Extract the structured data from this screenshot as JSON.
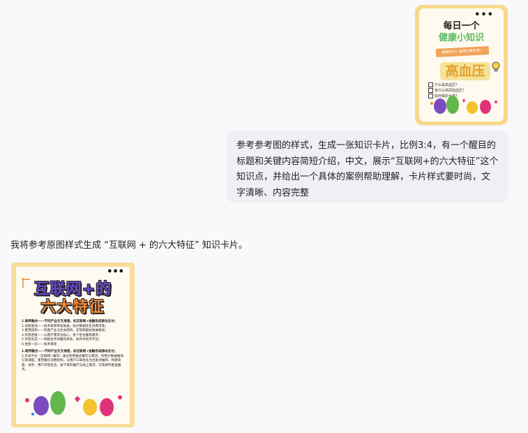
{
  "reference_card": {
    "title_line1": "每日一个",
    "title_line2": "健康小知识",
    "tag": "健康知识！每周分享好看！",
    "big_word": "高血压",
    "questions": [
      "什么是高血压？",
      "有什么高风险血压？",
      "如何保护大家？"
    ]
  },
  "user_message": {
    "text": "参考参考图的样式，生成一张知识卡片，比例3:4，有一个醒目的标题和关键内容简短介绍，中文，展示“互联网+的六大特征”这个知识点，并给出一个具体的案例帮助理解，卡片样式要时尚，文字清晰、内容完整"
  },
  "assistant_message": {
    "text": "我将参考原图样式生成 “互联网 + 的六大特征” 知识卡片。"
  },
  "generated_card": {
    "title_line1": "互联网+的",
    "title_line2": "六大特征",
    "lines": [
      "1.跨界融合——不同产业交叉渗透，如互联网+金融形成移动支付；",
      "2.创新驱动——技术革新带动发展，如大数据优化消费决策；",
      "3.重塑结构——改变产业与社会结构，实现跨越式发展格局；",
      "4.开放连接——以用户需求为核心，各个性化推荐服务；",
      "5.开放生态——构建合作共赢的体系，加共享经济平台；",
      "6.连接一切——技术革新"
    ],
    "case_lines": [
      "1.跨界融合——不同产业交叉渗透，如互联网+金融形成移动支付；",
      "2.外卖平台（互联网+餐饮）通过跨界融合餐饮与物流，利用大数据推动订单调度，重塑餐饮消费结构，以用户口味优化为出发点推荐，构建商家、骑手、用户开放生态，接下来的餐厅与线上需求，实现即时配送服务。"
    ]
  }
}
